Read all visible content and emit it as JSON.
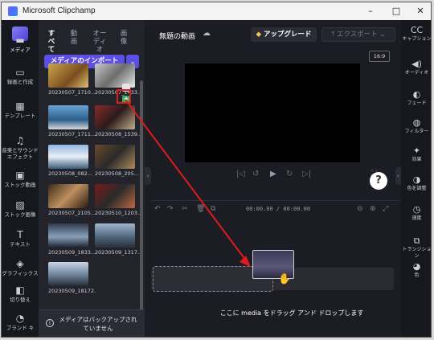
{
  "window": {
    "title": "Microsoft Clipchamp",
    "controls": [
      "–",
      "□",
      "✕"
    ]
  },
  "left_rail": [
    {
      "icon": "folder-icon",
      "glyph": "▬",
      "label": "メディア",
      "active": true
    },
    {
      "icon": "record-icon",
      "glyph": "▭",
      "label": "録画と作成"
    },
    {
      "icon": "templates-icon",
      "glyph": "▦",
      "label": "テンプレート"
    },
    {
      "icon": "music-icon",
      "glyph": "♫",
      "label": "音楽とサウンドエフェクト"
    },
    {
      "icon": "stock-video-icon",
      "glyph": "▣",
      "label": "ストック動画"
    },
    {
      "icon": "stock-image-icon",
      "glyph": "▨",
      "label": "ストック画像"
    },
    {
      "icon": "text-icon",
      "glyph": "T",
      "label": "テキスト"
    },
    {
      "icon": "graphics-icon",
      "glyph": "◈",
      "label": "グラフィックス"
    },
    {
      "icon": "transitions-icon",
      "glyph": "◧",
      "label": "切り替え"
    },
    {
      "icon": "brand-kit-icon",
      "glyph": "◔",
      "label": "ブランド キ"
    }
  ],
  "media_panel": {
    "tabs": [
      "すべて",
      "動画",
      "オーディオ",
      "画像"
    ],
    "import_label": "メディアのインポート",
    "import_dropdown": "⌄",
    "items": [
      {
        "label": "20230507_1710..."
      },
      {
        "label": "20230507_1433..."
      },
      {
        "label": "20230507_1711..."
      },
      {
        "label": "20230508_1539..."
      },
      {
        "label": "20230508_082..."
      },
      {
        "label": "20230508_205..."
      },
      {
        "label": "20230507_2105..."
      },
      {
        "label": "20230510_1203..."
      },
      {
        "label": "20230509_1833..."
      },
      {
        "label": "20230509_1317..."
      },
      {
        "label": "20230509_18172..."
      }
    ],
    "backup_notice": "メディアはバックアップされていません",
    "add_button": "+"
  },
  "main": {
    "project_title": "無題の動画",
    "upgrade_label": "アップグレード",
    "export_label": "エクスポート",
    "aspect_ratio": "16:9",
    "help": "?",
    "timecode": "00:00.00 / 00:00.00",
    "drop_text": "ここに media をドラッグ アンド ドロップします"
  },
  "right_rail": [
    {
      "icon": "captions-icon",
      "glyph": "CC",
      "label": "キャプション"
    },
    {
      "icon": "audio-icon",
      "glyph": "◀)",
      "label": "オーディオ"
    },
    {
      "icon": "fade-icon",
      "glyph": "◐",
      "label": "フェード"
    },
    {
      "icon": "filter-icon",
      "glyph": "◍",
      "label": "フィルター"
    },
    {
      "icon": "effects-icon",
      "glyph": "✦",
      "label": "効果"
    },
    {
      "icon": "color-icon",
      "glyph": "◑",
      "label": "色を調整"
    },
    {
      "icon": "speed-icon",
      "glyph": "◷",
      "label": "速度"
    },
    {
      "icon": "transition-icon",
      "glyph": "⧉",
      "label": "トランジション"
    },
    {
      "icon": "color-wheel-icon",
      "glyph": "◕",
      "label": "色"
    }
  ],
  "colors": {
    "accent": "#5b4fe6",
    "add_green": "#2fb25a",
    "arrow_red": "#e01b1b"
  }
}
